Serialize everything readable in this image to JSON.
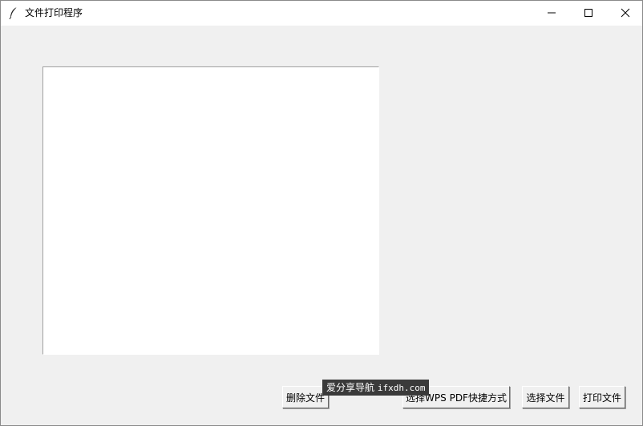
{
  "window": {
    "title": "文件打印程序",
    "app_icon": "feather-icon",
    "controls": {
      "minimize_icon": "minimize-icon",
      "maximize_icon": "maximize-icon",
      "close_icon": "close-icon"
    }
  },
  "file_list": {
    "items": []
  },
  "buttons": {
    "delete_label": "删除文件",
    "wps_label": "选择WPS PDF快捷方式",
    "select_label": "选择文件",
    "print_label": "打印文件"
  },
  "watermark": {
    "text": "爱分享导航",
    "domain": "ifxdh.com"
  },
  "colors": {
    "window_bg": "#f0f0f0",
    "list_bg": "#ffffff",
    "watermark_bg": "#3a3a3a"
  }
}
